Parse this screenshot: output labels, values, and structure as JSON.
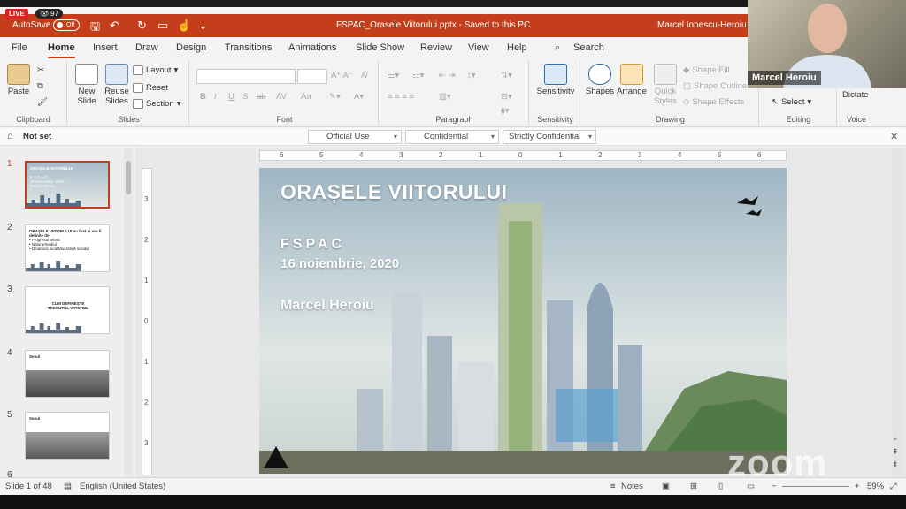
{
  "stream": {
    "live_label": "LIVE",
    "viewers": "97"
  },
  "titlebar": {
    "autosave_label": "AutoSave",
    "autosave_state": "Off",
    "document": "FSPAC_Orasele Viitorului.pptx  -  Saved to this PC",
    "user": "Marcel Ionescu-Heroiu"
  },
  "menu": {
    "file": "File",
    "home": "Home",
    "insert": "Insert",
    "draw": "Draw",
    "design": "Design",
    "transitions": "Transitions",
    "animations": "Animations",
    "slideshow": "Slide Show",
    "review": "Review",
    "view": "View",
    "help": "Help",
    "search": "Search"
  },
  "ribbon": {
    "clipboard": {
      "label": "Clipboard",
      "paste": "Paste"
    },
    "slides": {
      "label": "Slides",
      "new_slide": "New Slide",
      "reuse_slides": "Reuse Slides",
      "layout": "Layout",
      "reset": "Reset",
      "section": "Section"
    },
    "font": {
      "label": "Font",
      "bold": "B",
      "italic": "I",
      "underline": "U",
      "strike": "S",
      "ab": "ab",
      "av": "AV",
      "aa": "Aa"
    },
    "paragraph": {
      "label": "Paragraph"
    },
    "sensitivity": {
      "label": "Sensitivity",
      "button": "Sensitivity"
    },
    "drawing": {
      "label": "Drawing",
      "shapes": "Shapes",
      "arrange": "Arrange",
      "quick_styles": "Quick Styles",
      "shape_fill": "Shape Fill",
      "shape_outline": "Shape Outline",
      "shape_effects": "Shape Effects"
    },
    "editing": {
      "label": "Editing",
      "select": "Select"
    },
    "voice": {
      "label": "Voice",
      "dictate": "Dictate"
    }
  },
  "sensitivity_bar": {
    "status": "Not set",
    "official": "Official Use",
    "confidential": "Confidential",
    "strict": "Strictly Confidential"
  },
  "ruler": {
    "h": [
      "6",
      "5",
      "4",
      "3",
      "2",
      "1",
      "0",
      "1",
      "2",
      "3",
      "4",
      "5",
      "6"
    ],
    "v": [
      "3",
      "2",
      "1",
      "0",
      "1",
      "2",
      "3"
    ]
  },
  "thumbnails": [
    {
      "num": "1",
      "title": "ORAȘELE VIITORULUI",
      "sub": "F S P A C\n16 noiembrie, 2020\nMarcel Heroiu"
    },
    {
      "num": "2",
      "title": "ORAȘELE VIITORULUI au fost și vor fi definite de",
      "sub": "• Progresul tehnic\n• Natura/mediul\n• Dinamica locală/lucrativă socială"
    },
    {
      "num": "3",
      "title": "CUM DEFINEȘTE TRECUTUL VIITORUL",
      "sub": ""
    },
    {
      "num": "4",
      "title": "Seoul",
      "sub": ""
    },
    {
      "num": "5",
      "title": "Seoul",
      "sub": ""
    },
    {
      "num": "6",
      "title": "",
      "sub": ""
    }
  ],
  "slide": {
    "title": "ORAȘELE VIITORULUI",
    "org": "FSPAC",
    "date": "16 noiembrie, 2020",
    "author": "Marcel Heroiu"
  },
  "status": {
    "slide": "Slide 1 of 48",
    "language": "English (United States)",
    "notes": "Notes",
    "zoom": "59%"
  },
  "webcam": {
    "name": "Marcel Heroiu"
  },
  "overlay": {
    "logo": "zoom"
  },
  "colors": {
    "accent": "#c43e1c"
  }
}
